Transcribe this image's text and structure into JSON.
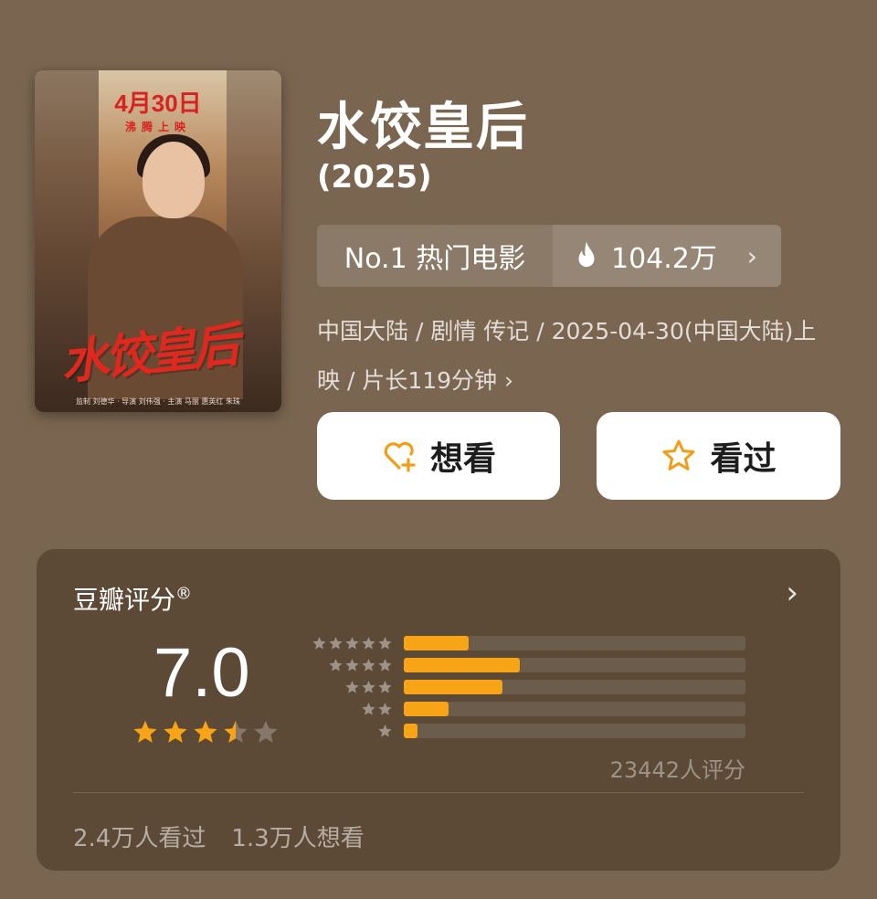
{
  "poster": {
    "date_text": "4月30日",
    "date_sub": "沸腾上映",
    "title_art": "水饺皇后",
    "credits": "监制 刘德华 · 导演 刘伟强 · 主演 马丽 惠英红 朱珠"
  },
  "movie": {
    "title": "水饺皇后",
    "year": "(2025)",
    "rank": "No.1 热门电影",
    "heat": "104.2万",
    "meta": "中国大陆 / 剧情 传记 / 2025-04-30(中国大陆)上映 / 片长119分钟 ›"
  },
  "actions": {
    "want_label": "想看",
    "seen_label": "看过"
  },
  "rating": {
    "label": "豆瓣评分",
    "mark": "®",
    "score": "7.0",
    "stars_out_of_5": 3.5,
    "distribution": [
      {
        "stars": 5,
        "fraction": 0.19
      },
      {
        "stars": 4,
        "fraction": 0.34
      },
      {
        "stars": 3,
        "fraction": 0.29
      },
      {
        "stars": 2,
        "fraction": 0.13
      },
      {
        "stars": 1,
        "fraction": 0.04
      }
    ],
    "count_text": "23442人评分",
    "seen_text": "2.4万人看过",
    "want_text": "1.3万人想看"
  },
  "colors": {
    "background": "#7a6550",
    "card": "#5c4a37",
    "accent": "#f7a416"
  },
  "icons": {
    "heat": "flame-icon",
    "want": "heart-plus-icon",
    "seen": "star-outline-icon"
  }
}
